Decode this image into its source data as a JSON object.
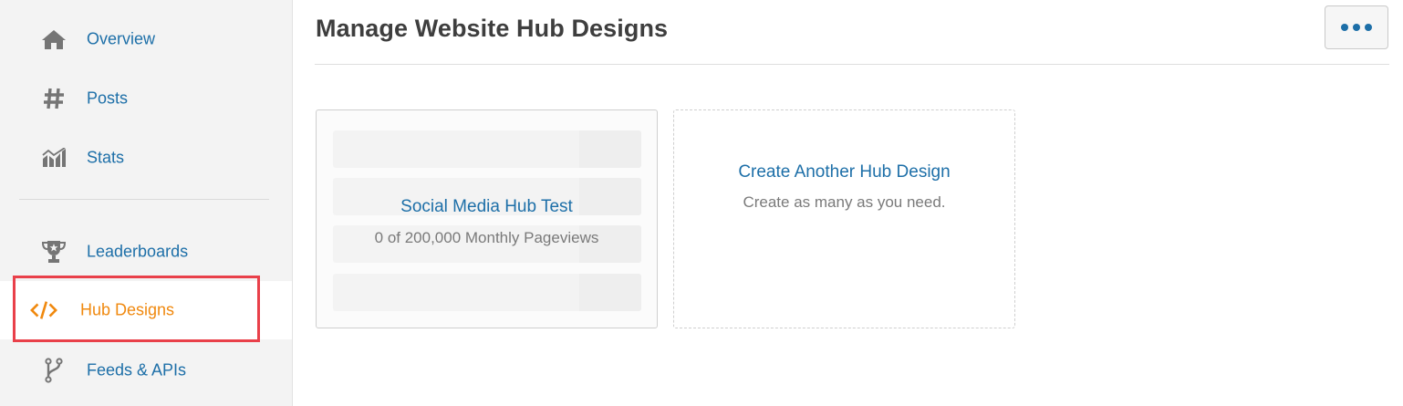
{
  "sidebar": {
    "items": [
      {
        "label": "Overview",
        "icon": "home-icon"
      },
      {
        "label": "Posts",
        "icon": "hashtag-icon"
      },
      {
        "label": "Stats",
        "icon": "stats-icon"
      },
      {
        "label": "Leaderboards",
        "icon": "trophy-icon"
      },
      {
        "label": "Hub Designs",
        "icon": "code-icon",
        "active": true
      },
      {
        "label": "Feeds & APIs",
        "icon": "fork-icon"
      }
    ]
  },
  "header": {
    "title": "Manage Website Hub Designs",
    "more_button_icon": "more-dots-icon"
  },
  "cards": [
    {
      "title": "Social Media Hub Test",
      "subtitle": "0 of 200,000 Monthly Pageviews"
    },
    {
      "title": "Create Another Hub Design",
      "subtitle": "Create as many as you need."
    }
  ],
  "colors": {
    "link_blue": "#1d6fa8",
    "active_orange": "#f0890f",
    "highlight_red": "#e9404a",
    "sidebar_bg": "#f3f3f3"
  }
}
